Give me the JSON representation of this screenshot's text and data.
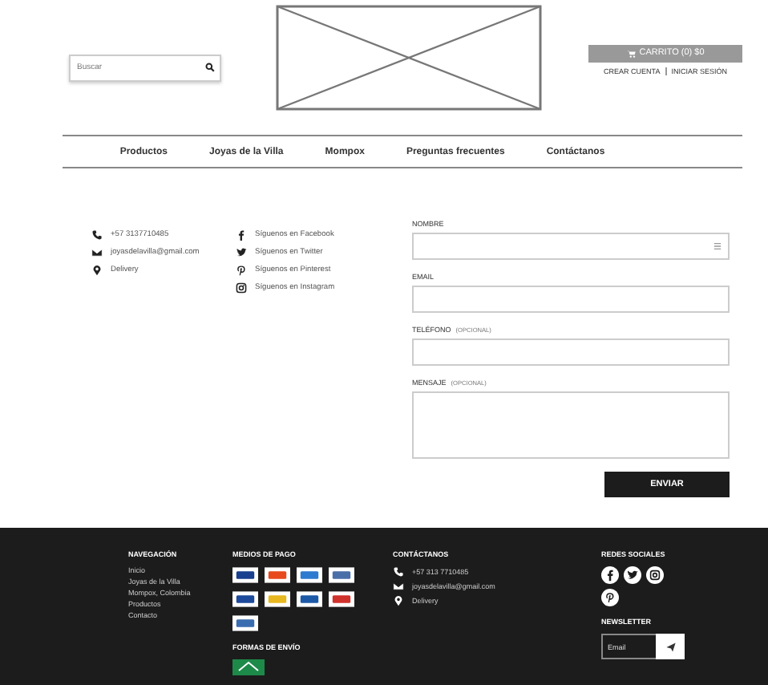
{
  "header": {
    "search": {
      "placeholder": "Buscar"
    },
    "cart": "CARRITO (0) $0",
    "account_links": [
      "CREAR CUENTA",
      "INICIAR SESIÓN"
    ]
  },
  "nav": [
    "Productos",
    "Joyas de la Villa",
    "Mompox",
    "Preguntas frecuentes",
    "Contáctanos"
  ],
  "contact": [
    {
      "kind": "phone",
      "text": "+57 3137710485"
    },
    {
      "kind": "mail",
      "text": "joyasdelavilla@gmail.com"
    },
    {
      "kind": "pin",
      "text": "Delivery"
    }
  ],
  "social": [
    {
      "kind": "facebook",
      "text": "Síguenos en Facebook"
    },
    {
      "kind": "twitter",
      "text": "Síguenos en Twitter"
    },
    {
      "kind": "pinterest",
      "text": "Síguenos en Pinterest"
    },
    {
      "kind": "instagram",
      "text": "Síguenos en Instagram"
    }
  ],
  "form": {
    "fields": [
      {
        "kind": "line",
        "label": "NOMBRE",
        "autofill": true
      },
      {
        "kind": "line",
        "label": "EMAIL"
      },
      {
        "kind": "line",
        "label": "TELÉFONO",
        "note": "(OPCIONAL)"
      },
      {
        "kind": "area",
        "label": "MENSAJE",
        "note": "(OPCIONAL)"
      }
    ],
    "submit": "ENVIAR"
  },
  "footer": {
    "navigation": {
      "title": "NAVEGACIÓN",
      "links": [
        "Inicio",
        "Joyas de la Villa",
        "Mompox, Colombia",
        "Productos",
        "Contacto"
      ]
    },
    "payment": {
      "title": "MEDIOS DE PAGO",
      "methods": [
        {
          "kind": "visa"
        },
        {
          "kind": "mastercard"
        },
        {
          "kind": "amex"
        },
        {
          "kind": "diners"
        },
        {
          "kind": "paypal"
        },
        {
          "kind": "baloto"
        },
        {
          "kind": "pse"
        },
        {
          "kind": "efecty"
        },
        {
          "kind": "bank"
        }
      ]
    },
    "shipping": {
      "title": "FORMAS DE ENVÍO"
    },
    "contact": {
      "title": "CONTÁCTANOS",
      "items": [
        {
          "kind": "phone",
          "text": "+57 313 7710485"
        },
        {
          "kind": "mail",
          "text": "joyasdelavilla@gmail.com"
        },
        {
          "kind": "pin",
          "text": "Delivery"
        }
      ]
    },
    "social": {
      "title": "REDES SOCIALES",
      "networks": [
        {
          "kind": "facebook"
        },
        {
          "kind": "twitter"
        },
        {
          "kind": "instagram"
        },
        {
          "kind": "pinterest"
        }
      ]
    },
    "newsletter": {
      "title": "NEWSLETTER",
      "placeholder": "Email"
    }
  }
}
